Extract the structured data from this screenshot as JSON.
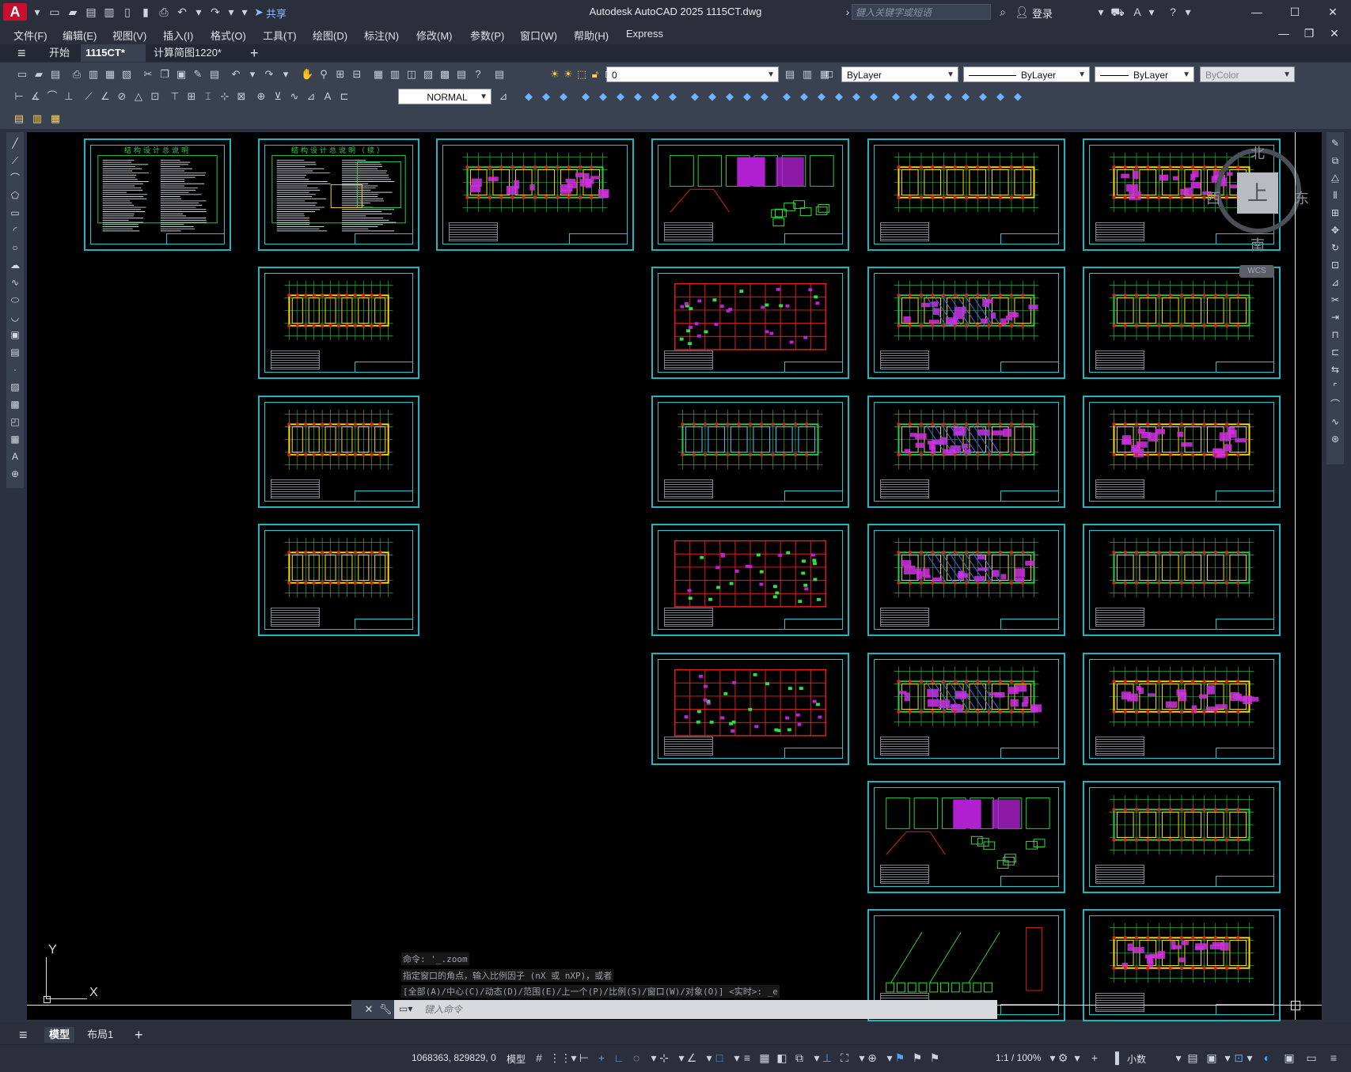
{
  "window": {
    "app_logo": "A",
    "title": "Autodesk AutoCAD 2025    1115CT.dwg",
    "share_label": "共享",
    "search_placeholder": "键入关键字或短语",
    "login_label": "登录"
  },
  "menu": [
    "文件(F)",
    "编辑(E)",
    "视图(V)",
    "插入(I)",
    "格式(O)",
    "工具(T)",
    "绘图(D)",
    "标注(N)",
    "修改(M)",
    "参数(P)",
    "窗口(W)",
    "帮助(H)",
    "Express"
  ],
  "tabs": {
    "start": "开始",
    "active": "1115CT*",
    "other": "计算简图1220*",
    "add": "+"
  },
  "toolbar": {
    "layer_value": "0",
    "text_style": "NORMAL",
    "color": "ByLayer",
    "linetype": "ByLayer",
    "lineweight": "ByLayer",
    "plot_style": "ByColor"
  },
  "viewcube": {
    "north": "北",
    "south": "南",
    "east": "东",
    "west": "西",
    "face": "上",
    "wcs": "WCS"
  },
  "ucs": {
    "x": "X",
    "y": "Y"
  },
  "command": {
    "history": [
      "命令: '_.zoom",
      "指定窗口的角点，输入比例因子 (nX 或 nXP)，或者",
      "[全部(A)/中心(C)/动态(D)/范围(E)/上一个(P)/比例(S)/窗口(W)/对象(O)] <实时>: _e"
    ],
    "input_placeholder": "键入命令"
  },
  "layouts": {
    "model": "模型",
    "layout1": "布局1",
    "add": "+"
  },
  "status": {
    "coordinates": "1068363, 829829, 0",
    "model": "模型",
    "scale": "1:1 / 100%",
    "units": "小数"
  },
  "sheets": {
    "sheet1_title": "结构设计总说明",
    "sheet2_title": "结构设计总说明（续）"
  }
}
